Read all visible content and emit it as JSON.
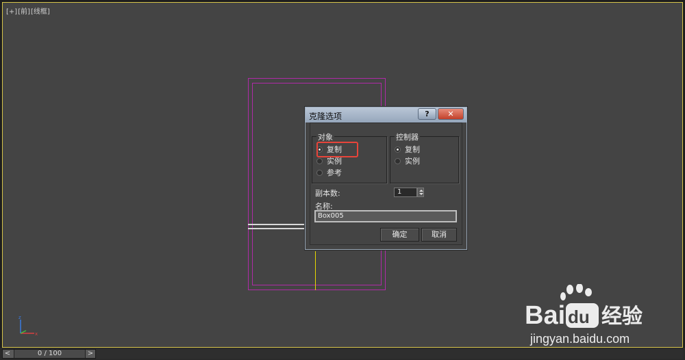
{
  "viewport": {
    "label_parts": [
      "[+]",
      "[前]",
      "[线框]"
    ]
  },
  "dialog": {
    "title": "克隆选项",
    "help_label": "?",
    "close_label": "✕",
    "object_group": {
      "title": "对象",
      "options": [
        {
          "label": "复制",
          "selected": true
        },
        {
          "label": "实例",
          "selected": false
        },
        {
          "label": "参考",
          "selected": false
        }
      ]
    },
    "controller_group": {
      "title": "控制器",
      "options": [
        {
          "label": "复制",
          "selected": true
        },
        {
          "label": "实例",
          "selected": false
        }
      ]
    },
    "copies_label": "副本数:",
    "copies_value": "1",
    "name_label": "名称:",
    "name_value": "Box005",
    "ok_label": "确定",
    "cancel_label": "取消"
  },
  "timebar": {
    "prev_label": "<",
    "next_label": ">",
    "frame_text": "0 / 100"
  },
  "watermark": {
    "brand_text": "Bai",
    "brand_du": "du",
    "brand_cn": "经验",
    "url": "jingyan.baidu.com"
  },
  "colors": {
    "highlight_red": "#e8443a",
    "wireframe_purple": "#b02aa8",
    "viewport_border": "#d8c64a"
  }
}
